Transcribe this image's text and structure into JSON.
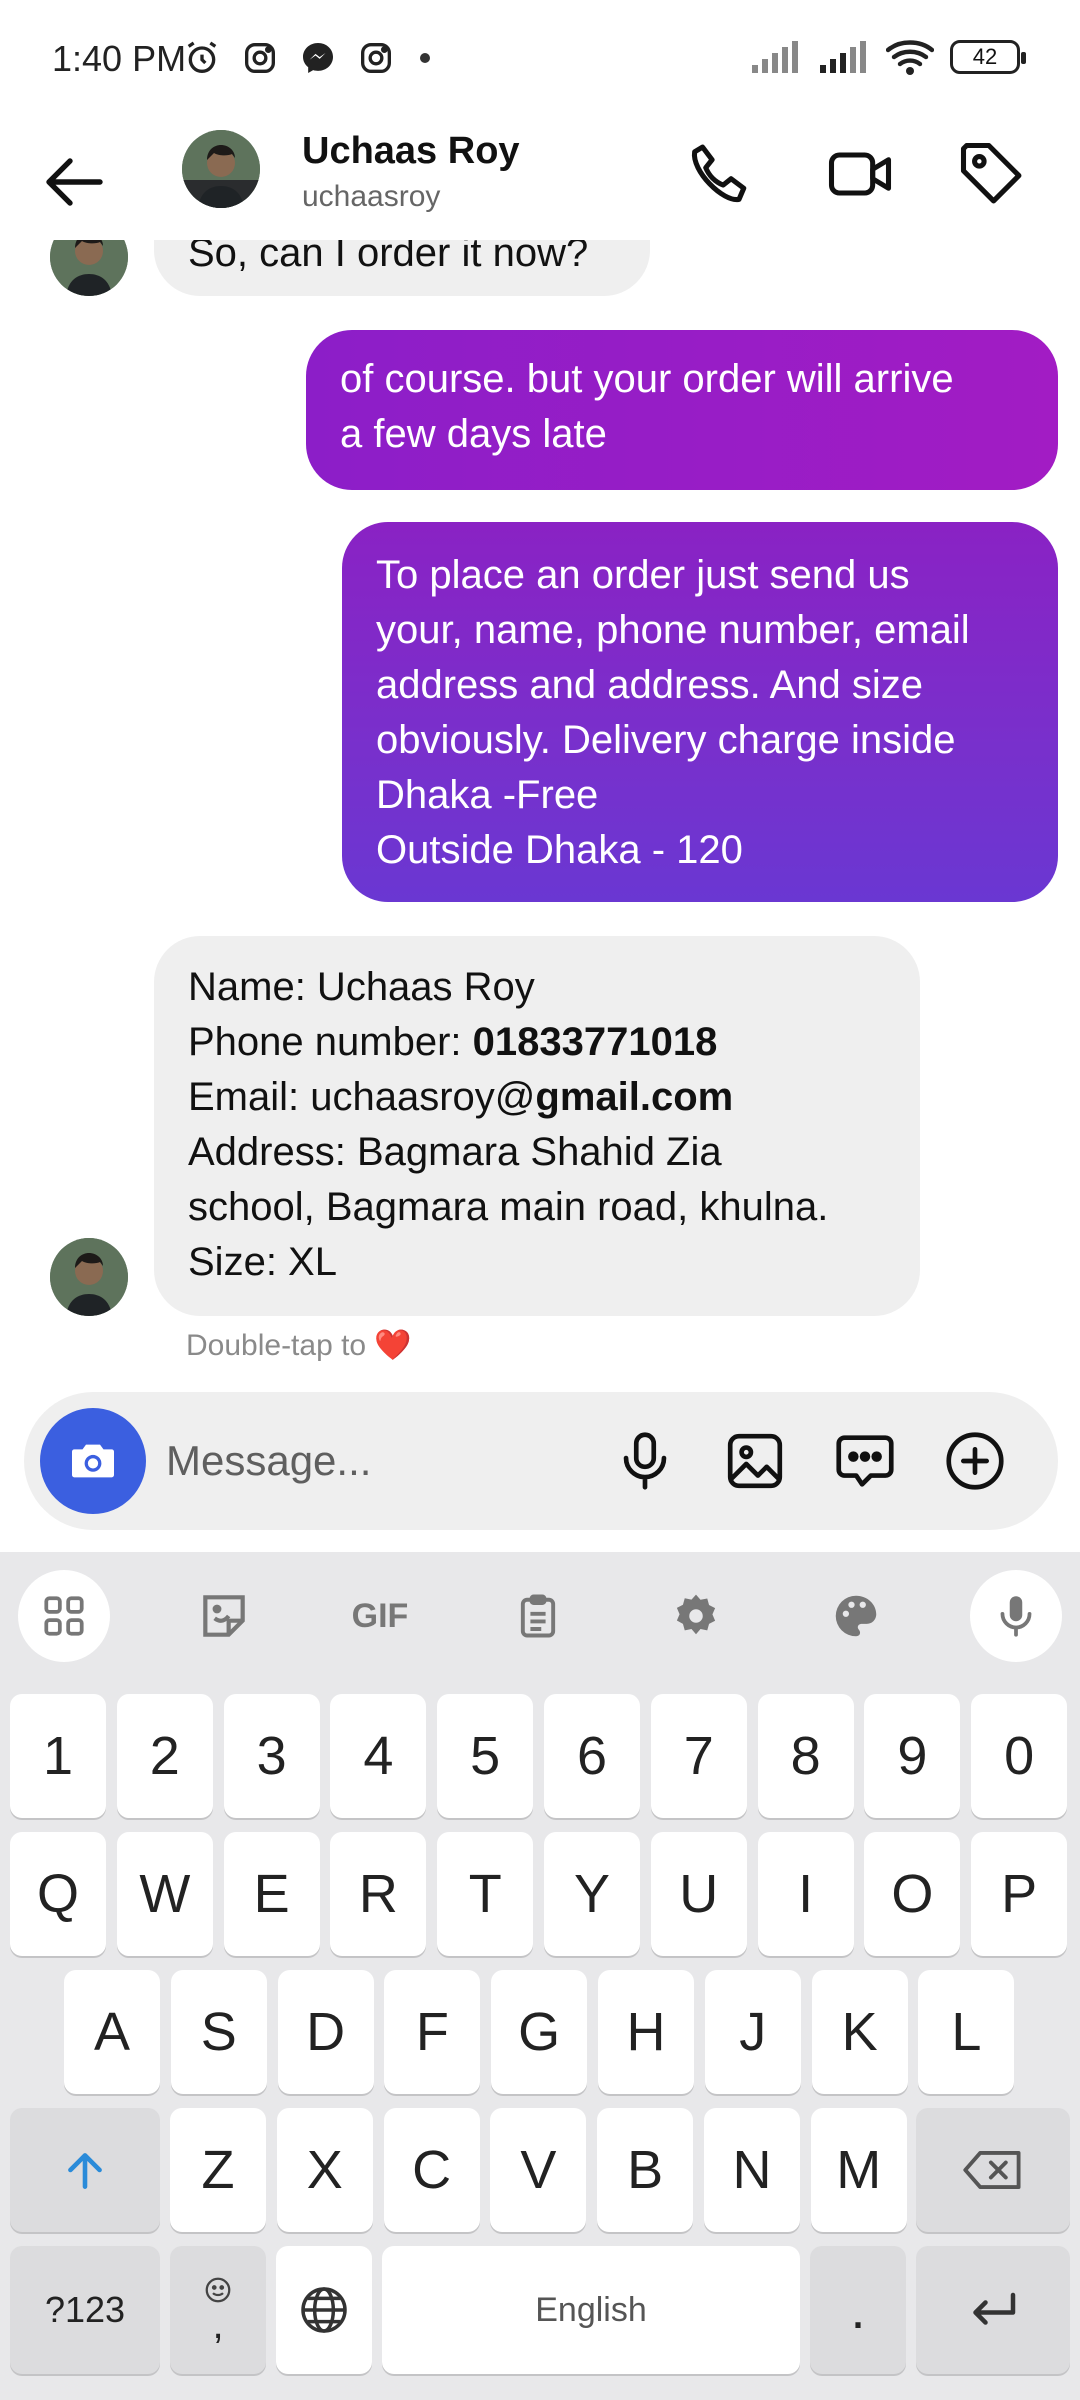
{
  "status_bar": {
    "time": "1:40 PM",
    "battery": "42",
    "icons": [
      "alarm-icon",
      "instagram-icon",
      "messenger-icon",
      "instagram-icon"
    ]
  },
  "header": {
    "contact_name": "Uchaas Roy",
    "username": "uchaasroy",
    "actions": [
      "phone-icon",
      "video-icon",
      "tag-icon"
    ]
  },
  "messages": [
    {
      "direction": "in",
      "lines": [
        "So, can I order it now?"
      ]
    },
    {
      "direction": "out",
      "lines": [
        "of course. but your order will arrive",
        "a few days late"
      ]
    },
    {
      "direction": "out",
      "lines": [
        "To place an order just send us",
        "your, name, phone number, email",
        "address and address. And size",
        "obviously. Delivery charge inside",
        "Dhaka -Free",
        "Outside Dhaka - 120"
      ]
    },
    {
      "direction": "in",
      "lines_rich": [
        [
          "Name: Uchaas Roy"
        ],
        [
          "Phone number: ",
          "01833771018"
        ],
        [
          "Email: uchaasroy@",
          "gmail.com"
        ],
        [
          "Address: Bagmara Shahid Zia"
        ],
        [
          "school, Bagmara main road, khulna."
        ],
        [
          "Size: XL"
        ]
      ]
    }
  ],
  "hint": {
    "text": "Double-tap to",
    "emoji": "❤️"
  },
  "composer": {
    "placeholder": "Message..."
  },
  "keyboard": {
    "row_numbers": [
      "1",
      "2",
      "3",
      "4",
      "5",
      "6",
      "7",
      "8",
      "9",
      "0"
    ],
    "row_1": [
      "Q",
      "W",
      "E",
      "R",
      "T",
      "Y",
      "U",
      "I",
      "O",
      "P"
    ],
    "row_2": [
      "A",
      "S",
      "D",
      "F",
      "G",
      "H",
      "J",
      "K",
      "L"
    ],
    "row_3": [
      "Z",
      "X",
      "C",
      "V",
      "B",
      "N",
      "M"
    ],
    "symbols_key": "?123",
    "comma_key": ",",
    "space_label": "English",
    "period_key": ".",
    "toolbar": {
      "gif_label": "GIF"
    }
  }
}
